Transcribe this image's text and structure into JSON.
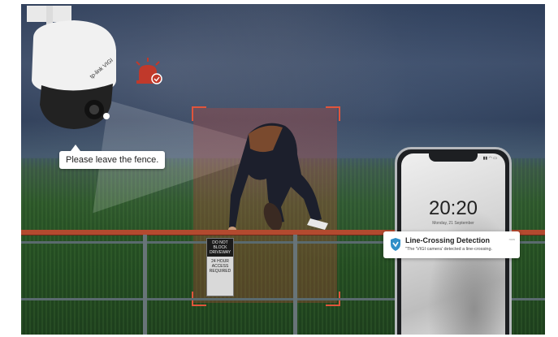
{
  "camera": {
    "icon": "security-camera-icon",
    "brand_text": "tp-link VIGI"
  },
  "alarm": {
    "icon": "alarm-siren-icon",
    "color": "#c0392b"
  },
  "speech_bubble": {
    "text": "Please leave the fence."
  },
  "detection": {
    "box_color": "#e0553c"
  },
  "sign": {
    "top_text": "DO NOT BLOCK DRIVEWAY",
    "bottom_text": "24 HOUR ACCESS REQUIRED"
  },
  "phone": {
    "time": "20:20",
    "date": "Monday, 21 September"
  },
  "notification": {
    "icon": "vigi-shield-icon",
    "title": "Line-Crossing Detection",
    "body": "\"The 'VIGI camera' detected a line-crossing.",
    "time": "now"
  }
}
